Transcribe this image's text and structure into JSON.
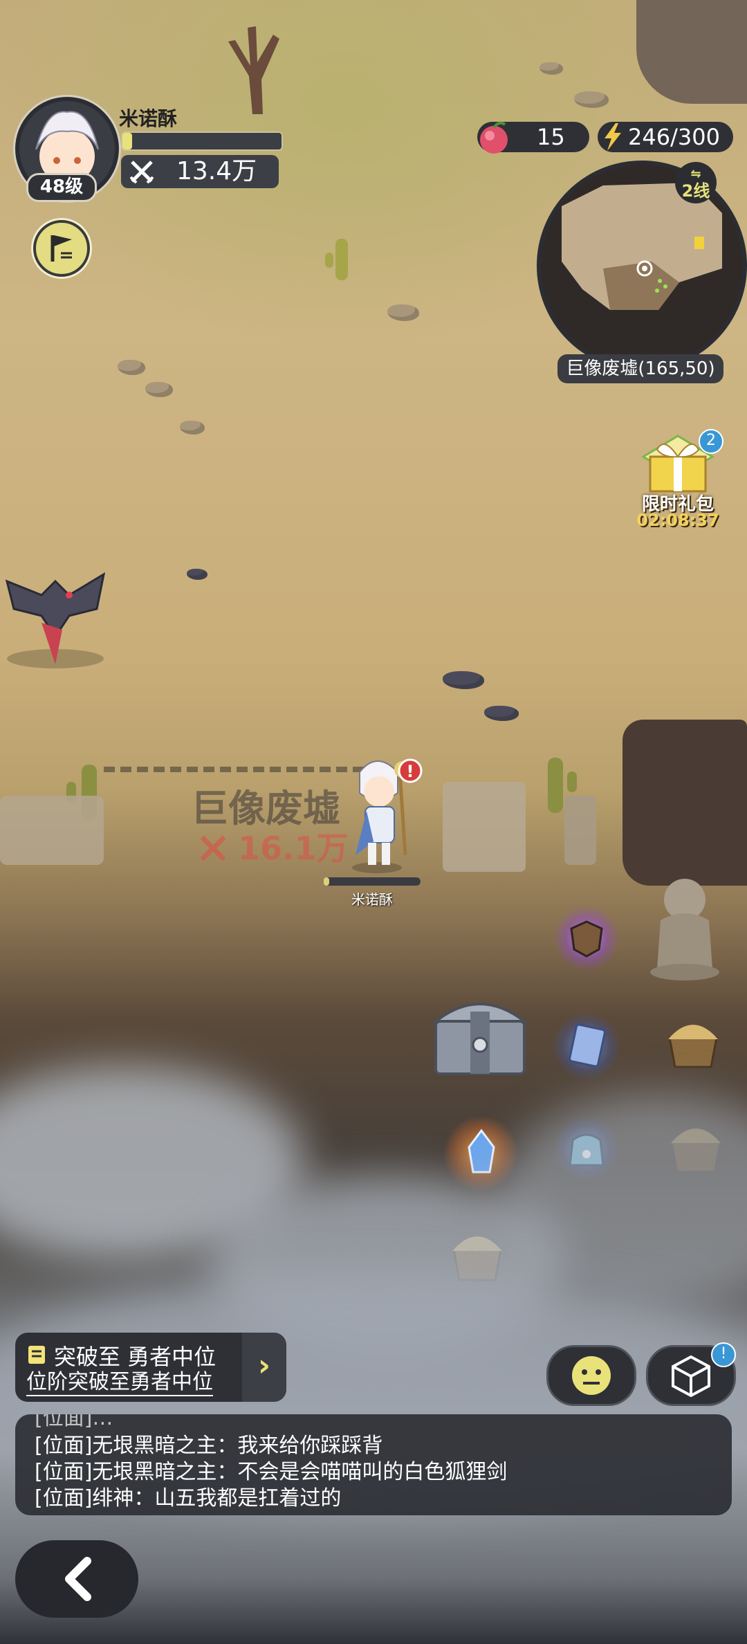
{
  "player": {
    "name": "米诺酥",
    "level": "48级",
    "power": "13.4万",
    "exp_fraction": 0.06
  },
  "resources": {
    "stamina_food": "15",
    "energy": "246/300"
  },
  "minimap": {
    "line": "2线",
    "location": "巨像废墟(165,50)"
  },
  "gift": {
    "title": "限时礼包",
    "timer": "02:08:37",
    "badge": "2"
  },
  "zone": {
    "name": "巨像废墟",
    "required_power": "16.1万"
  },
  "character_label": "米诺酥",
  "quest": {
    "title": "突破至 勇者中位",
    "subtitle": "位阶突破至勇者中位"
  },
  "box_badge": "!",
  "chat": {
    "lines": [
      "[位面]无垠黑暗之主：我来给你踩踩背",
      "[位面]无垠黑暗之主：不会是会喵喵叫的白色狐狸剑",
      "[位面]绯神：山五我都是扛着过的"
    ]
  },
  "icons": {
    "flag": "flag-icon",
    "food": "peach-icon",
    "energy": "lightning-icon",
    "power": "crossed-swords-icon",
    "emoji": "neutral-face-icon",
    "box": "cube-icon",
    "back": "back-arrow-icon",
    "quest": "quest-scroll-icon"
  },
  "colors": {
    "accent_yellow": "#e9e27a",
    "panel_dark": "#2e3036",
    "danger_red": "#dc5046",
    "badge_blue": "#3a97d6"
  }
}
